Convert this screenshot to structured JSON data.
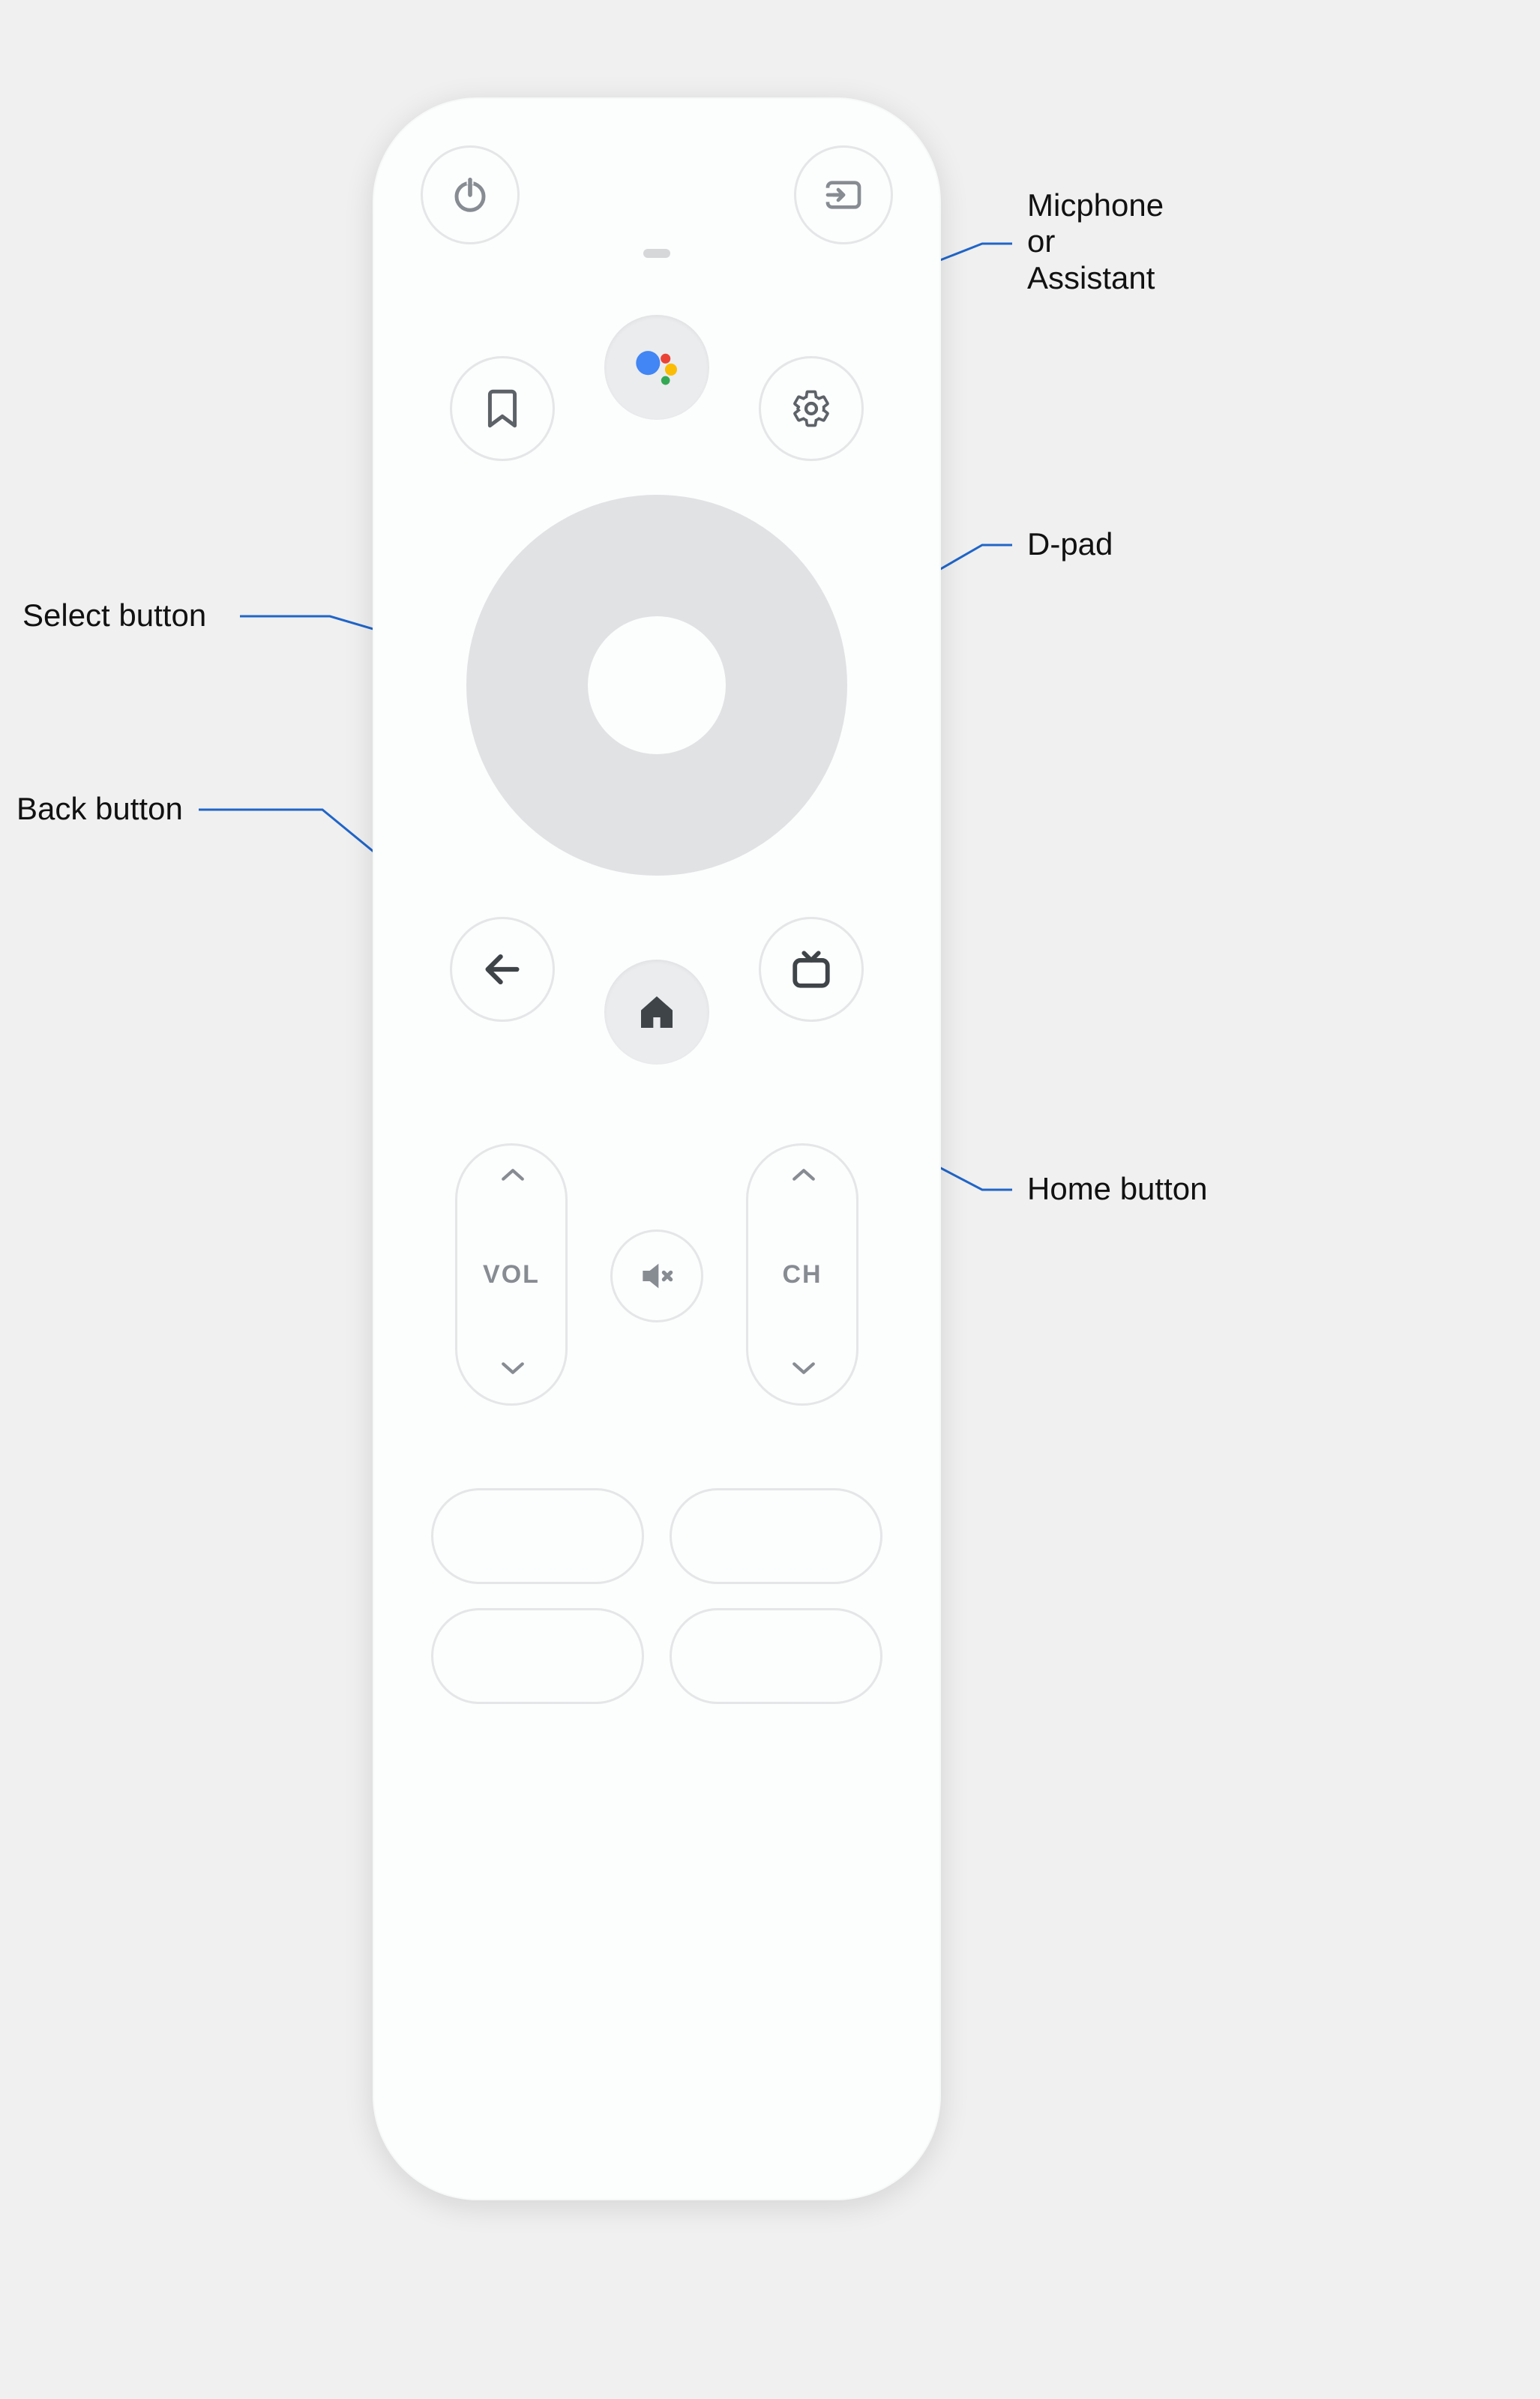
{
  "labels": {
    "mic": "Micphone\nor\nAssistant",
    "dpad": "D-pad",
    "select": "Select button",
    "back": "Back button",
    "home": "Home button"
  },
  "rockers": {
    "vol": "VOL",
    "ch": "CH"
  },
  "colors": {
    "leader": "#2065c8",
    "icon": "#5d6268",
    "assistant_blue": "#4285F4",
    "assistant_red": "#EA4335",
    "assistant_yellow": "#FBBC05",
    "assistant_green": "#34A853"
  }
}
